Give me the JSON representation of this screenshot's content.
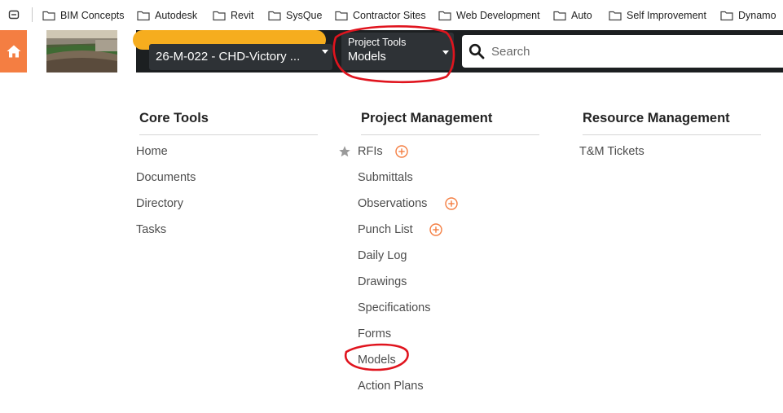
{
  "bookmarks": [
    {
      "label": "BIM Concepts"
    },
    {
      "label": "Autodesk"
    },
    {
      "label": "Revit"
    },
    {
      "label": "SysQue"
    },
    {
      "label": "Contractor Sites"
    },
    {
      "label": "Web Development"
    },
    {
      "label": "Auto"
    },
    {
      "label": "Self Improvement"
    },
    {
      "label": "Dynamo"
    }
  ],
  "header": {
    "project_selector": "26-M-022 - CHD-Victory ...",
    "tool_selector": {
      "label": "Project Tools",
      "value": "Models"
    },
    "search": {
      "placeholder": "Search"
    }
  },
  "menu": {
    "core_tools": {
      "heading": "Core Tools",
      "items": [
        "Home",
        "Documents",
        "Directory",
        "Tasks"
      ]
    },
    "project_management": {
      "heading": "Project Management",
      "items": [
        "RFIs",
        "Submittals",
        "Observations",
        "Punch List",
        "Daily Log",
        "Drawings",
        "Specifications",
        "Forms",
        "Models",
        "Action Plans"
      ]
    },
    "resource_management": {
      "heading": "Resource Management",
      "items": [
        "T&M Tickets"
      ]
    }
  },
  "colors": {
    "accent": "#f47e42",
    "topbar": "#1c1f21",
    "redaction": "#f6ad1e",
    "annotation": "#e0141e"
  }
}
